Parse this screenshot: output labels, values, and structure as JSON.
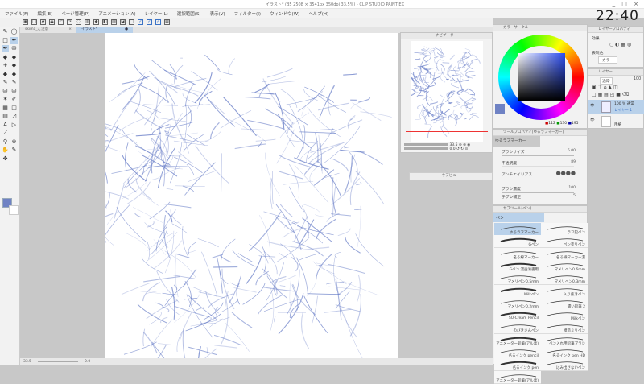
{
  "window": {
    "title": "イラスト* (B5 2508 × 3541px 350dpi 33.5%) - CLIP STUDIO PAINT EX",
    "controls": "_ □ ×"
  },
  "clock": "22:40",
  "menu": [
    "ファイル(F)",
    "編集(E)",
    "ページ管理(P)",
    "アニメーション(A)",
    "レイヤー(L)",
    "選択範囲(S)",
    "表示(V)",
    "フィルター(I)",
    "ウィンドウ(W)",
    "ヘルプ(H)"
  ],
  "tabs": [
    {
      "label": "skima_ご注意",
      "close": "×"
    },
    {
      "label": "イラスト*",
      "close": "●"
    }
  ],
  "colors": {
    "main": "#6f82c4",
    "sub": "#ffffff",
    "accent": "#b9d1ea",
    "sketch": "#6a7fc8"
  },
  "navigator": {
    "title": "ナビゲーター",
    "zoom": "33.5",
    "angle": "0.0"
  },
  "color_panel": {
    "title": "カラーサークル",
    "r": "112",
    "g": "130",
    "b": "195"
  },
  "layer_property": {
    "title": "レイヤープロパティ",
    "effect_label": "効果",
    "expression_label": "表現色",
    "expression_value": "カラー"
  },
  "layers": {
    "title": "レイヤー",
    "blend": "通常",
    "opacity": "100",
    "items": [
      {
        "mode": "100 % 通常",
        "name": "レイヤー 1",
        "selected": true
      },
      {
        "mode": "",
        "name": "用紙",
        "selected": false
      }
    ]
  },
  "tool_property": {
    "title": "ツールプロパティ[ゆるラフマーカー]",
    "brush_name": "ゆるラフマーカー",
    "props": [
      {
        "label": "ブラシサイズ",
        "value": "5.00"
      },
      {
        "label": "不透明度",
        "value": "89"
      },
      {
        "label": "アンチエイリアス",
        "value": ""
      },
      {
        "label": "ブラシ濃度",
        "value": "100"
      },
      {
        "label": "手ブレ補正",
        "value": "5"
      }
    ]
  },
  "gradation": {
    "title": "サブビュー"
  },
  "subtool": {
    "title": "サブツール[ペン]",
    "group": "ペン",
    "brushes": [
      "ゆるラフマーカー",
      "ラフ鉛ペン",
      "Gペン",
      "ペン塗りペン",
      "名る線マーカー",
      "名る線マーカー濃",
      "Gペン 漫画清書用",
      "マメリペン0.6mm",
      "マメリペン0.5mm",
      "マメリペン0.3mm",
      "Milkペン",
      "入り抜きペン",
      "マメリペン0.2mm",
      "濃い鉛筆 2",
      "SU-Cream Pencil",
      "Milkペン",
      "のびきさんペン",
      "模造ミリペン",
      "アニメーター鉛筆(アル素)",
      "ペン入れ用鉛筆ブラシ",
      "名るインク pencil",
      "名るインク pen HD",
      "名るインク pen",
      "はみ出さないペン",
      "アニメーター鉛筆(アル素)"
    ]
  },
  "statusbar": {
    "zoom": "33.5",
    "angle": "0.0"
  }
}
